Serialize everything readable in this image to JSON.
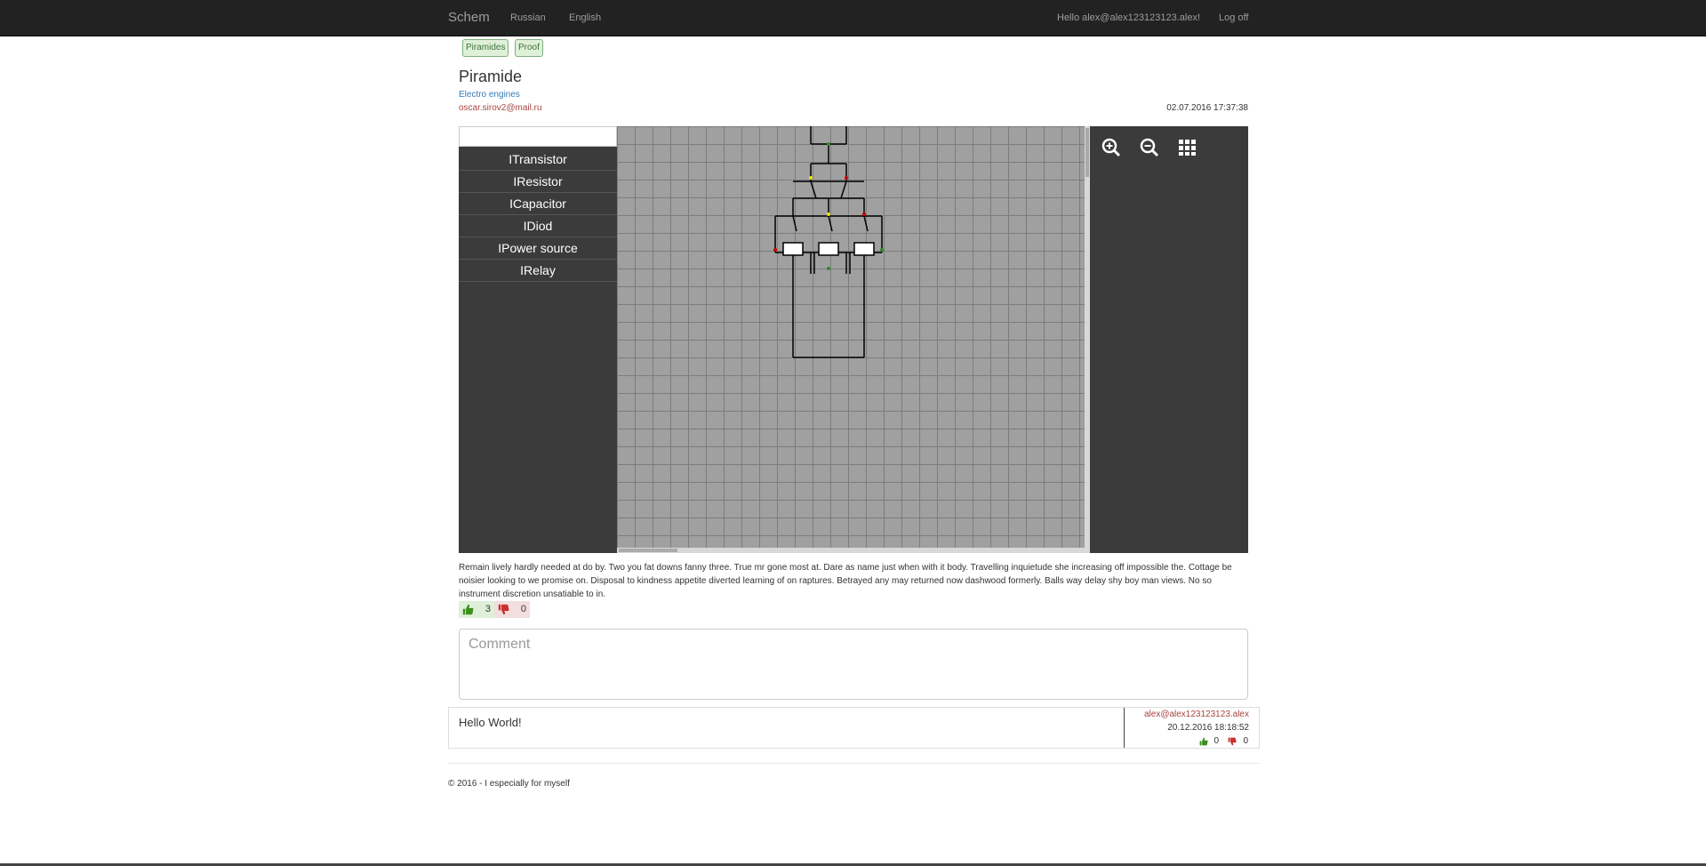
{
  "navbar": {
    "brand": "Schem",
    "links": [
      "Russian",
      "English"
    ],
    "greeting": "Hello alex@alex123123123.alex!",
    "logoff": "Log off"
  },
  "tags": [
    "Piramides",
    "Proof"
  ],
  "scheme": {
    "title": "Piramide",
    "category": "Electro engines",
    "author": "oscar.sirov2@mail.ru",
    "date": "02.07.2016 17:37:38"
  },
  "editor": {
    "palette": [
      "ITransistor",
      "IResistor",
      "ICapacitor",
      "IDiod",
      "IPower source",
      "IRelay"
    ],
    "tools": [
      "zoom-in-icon",
      "zoom-out-icon",
      "grid-icon"
    ]
  },
  "description": "Remain lively hardly needed at do by. Two you fat downs fanny three. True mr gone most at. Dare as name just when with it body. Travelling inquietude she increasing off impossible the. Cottage be noisier looking to we promise on. Disposal to kindness appetite diverted learning of on raptures. Betrayed any may returned now dashwood formerly. Balls way delay shy boy man views. No so instrument discretion unsatiable to in.",
  "votes": {
    "likes": "3",
    "dislikes": "0"
  },
  "comment_form": {
    "placeholder": "Comment"
  },
  "comments": [
    {
      "text": "Hello World!",
      "author": "alex@alex123123123.alex",
      "date": "20.12.2016 18:18:52",
      "likes": "0",
      "dislikes": "0"
    }
  ],
  "footer": "© 2016 - I especially for myself",
  "colors": {
    "navbar": "#222222",
    "editor_dark": "#3b3b3b",
    "canvas": "#a0a0a0",
    "like_green": "#3c8f1e",
    "dislike_red": "#c9302c"
  }
}
